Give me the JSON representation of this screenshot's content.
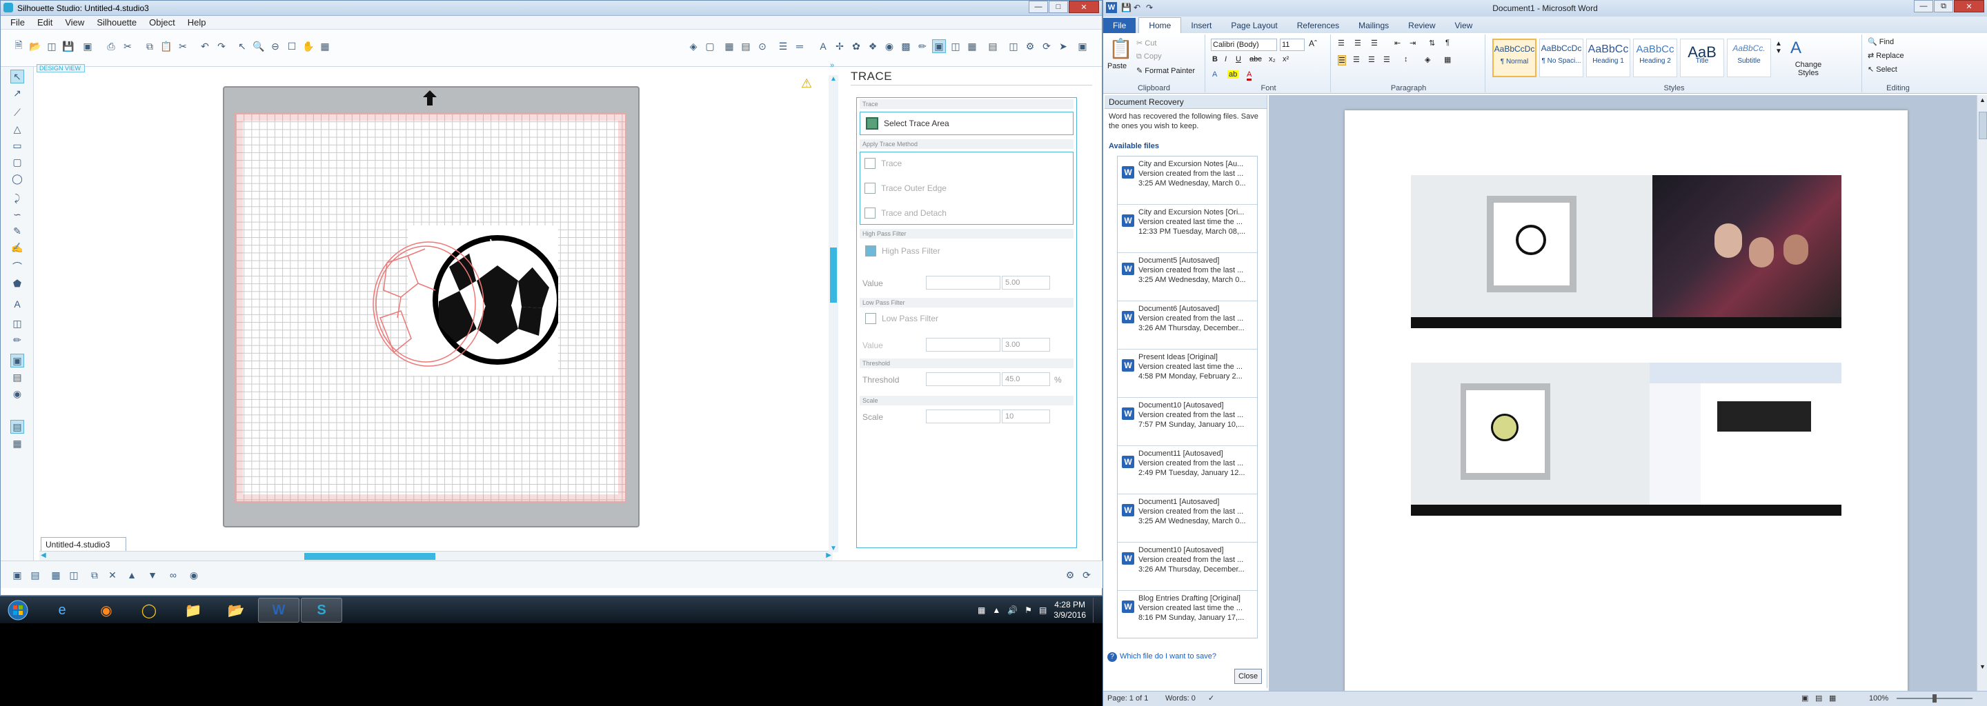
{
  "silhouette": {
    "title": "Silhouette Studio: Untitled-4.studio3",
    "menu": [
      "File",
      "Edit",
      "View",
      "Silhouette",
      "Object",
      "Help"
    ],
    "design_view_label": "DESIGN VIEW",
    "file_tab": "Untitled-4.studio3",
    "panel_title": "TRACE",
    "trace": {
      "section_trace": "Trace",
      "select_area": "Select Trace Area",
      "section_method": "Apply Trace Method",
      "trace_btn": "Trace",
      "outer_edge": "Trace Outer Edge",
      "detach": "Trace and Detach",
      "section_hpf": "High Pass Filter",
      "hpf_label": "High Pass Filter",
      "value_label": "Value",
      "hpf_value": "5.00",
      "section_lpf": "Low Pass Filter",
      "lpf_label": "Low Pass Filter",
      "lpf_value_label": "Value",
      "lpf_value": "3.00",
      "section_threshold": "Threshold",
      "threshold_label": "Threshold",
      "threshold_value": "45.0",
      "threshold_unit": "%",
      "section_scale": "Scale",
      "scale_label": "Scale",
      "scale_value": "10"
    }
  },
  "taskbar": {
    "time": "4:28 PM",
    "date": "3/9/2016"
  },
  "word": {
    "title": "Document1 - Microsoft Word",
    "tabs": [
      "File",
      "Home",
      "Insert",
      "Page Layout",
      "References",
      "Mailings",
      "Review",
      "View"
    ],
    "clipboard": {
      "paste": "Paste",
      "cut": "Cut",
      "copy": "Copy",
      "format_painter": "Format Painter",
      "label": "Clipboard"
    },
    "font": {
      "name": "Calibri (Body)",
      "size": "11",
      "label": "Font"
    },
    "paragraph_label": "Paragraph",
    "styles_label": "Styles",
    "styles": [
      {
        "preview": "AaBbCcDc",
        "name": "¶ Normal"
      },
      {
        "preview": "AaBbCcDc",
        "name": "¶ No Spaci..."
      },
      {
        "preview": "AaBbCc",
        "name": "Heading 1"
      },
      {
        "preview": "AaBbCc",
        "name": "Heading 2"
      },
      {
        "preview": "AaB",
        "name": "Title"
      },
      {
        "preview": "AaBbCc.",
        "name": "Subtitle"
      }
    ],
    "change_styles": "Change Styles",
    "editing": {
      "find": "Find",
      "replace": "Replace",
      "select": "Select",
      "label": "Editing"
    },
    "recovery": {
      "header": "Document Recovery",
      "message": "Word has recovered the following files.  Save the ones you wish to keep.",
      "available": "Available files",
      "files": [
        {
          "name": "City and Excursion Notes  [Au...",
          "l2": "Version created from the last ...",
          "l3": "3:25 AM Wednesday, March 0..."
        },
        {
          "name": "City and Excursion Notes  [Ori...",
          "l2": "Version created last time the ...",
          "l3": "12:33 PM Tuesday, March 08,..."
        },
        {
          "name": "Document5  [Autosaved]",
          "l2": "Version created from the last ...",
          "l3": "3:25 AM Wednesday, March 0..."
        },
        {
          "name": "Document6  [Autosaved]",
          "l2": "Version created from the last ...",
          "l3": "3:26 AM Thursday, December..."
        },
        {
          "name": "Present Ideas  [Original]",
          "l2": "Version created last time the ...",
          "l3": "4:58 PM Monday, February 2..."
        },
        {
          "name": "Document10  [Autosaved]",
          "l2": "Version created from the last ...",
          "l3": "7:57 PM Sunday, January 10,..."
        },
        {
          "name": "Document11  [Autosaved]",
          "l2": "Version created from the last ...",
          "l3": "2:49 PM Tuesday, January 12..."
        },
        {
          "name": "Document1  [Autosaved]",
          "l2": "Version created from the last ...",
          "l3": "3:25 AM Wednesday, March 0..."
        },
        {
          "name": "Document10  [Autosaved]",
          "l2": "Version created from the last ...",
          "l3": "3:26 AM Thursday, December..."
        },
        {
          "name": "Blog Entries Drafting  [Original]",
          "l2": "Version created last time the ...",
          "l3": "8:16 PM Sunday, January 17,..."
        }
      ],
      "which": "Which file do I want to save?",
      "close": "Close"
    },
    "status": {
      "page": "Page: 1 of 1",
      "words": "Words: 0",
      "zoom": "100%"
    }
  }
}
